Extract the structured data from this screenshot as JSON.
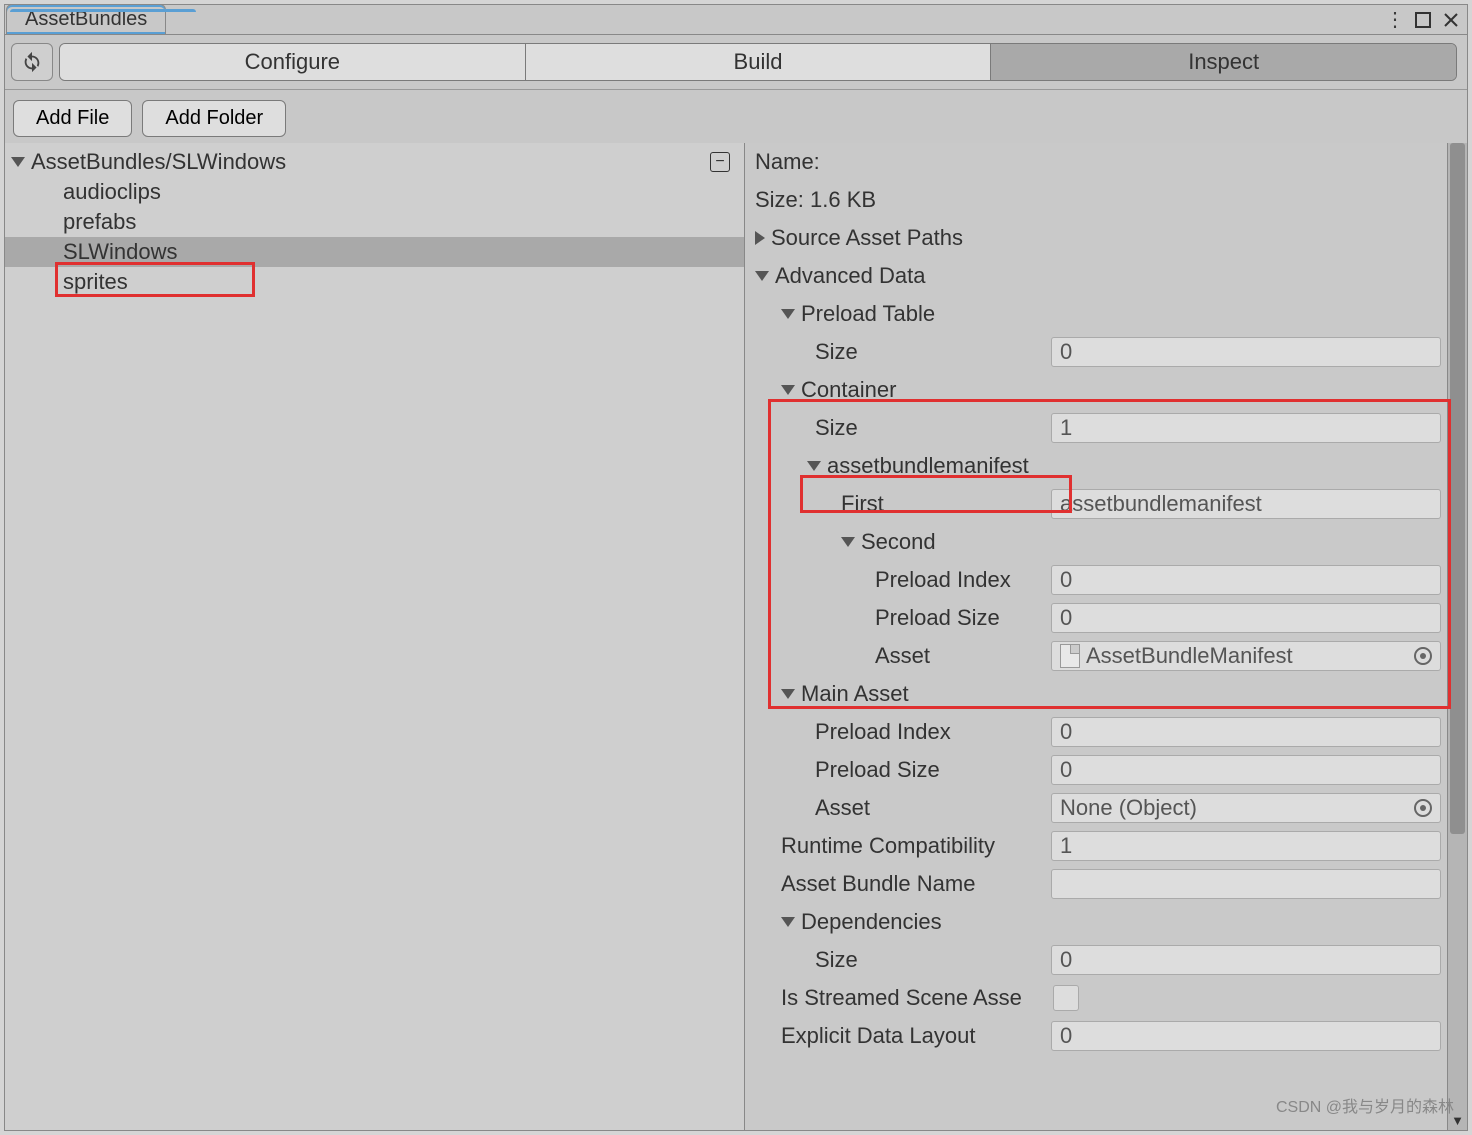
{
  "titlebar": {
    "tab": "AssetBundles"
  },
  "tabs": {
    "configure": "Configure",
    "build": "Build",
    "inspect": "Inspect"
  },
  "buttons": {
    "addFile": "Add File",
    "addFolder": "Add Folder"
  },
  "tree": {
    "root": "AssetBundles/SLWindows",
    "items": [
      "audioclips",
      "prefabs",
      "SLWindows",
      "sprites"
    ],
    "selectedIndex": 2
  },
  "inspect": {
    "nameLabel": "Name:",
    "sizeLabel": "Size: 1.6 KB",
    "sourceAssetPaths": "Source Asset Paths",
    "advancedData": "Advanced Data",
    "preloadTable": {
      "label": "Preload Table",
      "sizeLabel": "Size",
      "sizeValue": "0"
    },
    "container": {
      "label": "Container",
      "sizeLabel": "Size",
      "sizeValue": "1",
      "item": {
        "name": "assetbundlemanifest",
        "firstLabel": "First",
        "firstValue": "assetbundlemanifest",
        "secondLabel": "Second",
        "preloadIndexLabel": "Preload Index",
        "preloadIndexValue": "0",
        "preloadSizeLabel": "Preload Size",
        "preloadSizeValue": "0",
        "assetLabel": "Asset",
        "assetValue": "AssetBundleManifest"
      }
    },
    "mainAsset": {
      "label": "Main Asset",
      "preloadIndexLabel": "Preload Index",
      "preloadIndexValue": "0",
      "preloadSizeLabel": "Preload Size",
      "preloadSizeValue": "0",
      "assetLabel": "Asset",
      "assetValue": "None (Object)"
    },
    "runtimeCompatLabel": "Runtime Compatibility",
    "runtimeCompatValue": "1",
    "assetBundleNameLabel": "Asset Bundle Name",
    "assetBundleNameValue": "",
    "dependencies": {
      "label": "Dependencies",
      "sizeLabel": "Size",
      "sizeValue": "0"
    },
    "isStreamedLabel": "Is Streamed Scene Asse",
    "explicitDataLayoutLabel": "Explicit Data Layout",
    "explicitDataLayoutValue": "0"
  },
  "watermark": "CSDN @我与岁月的森林"
}
